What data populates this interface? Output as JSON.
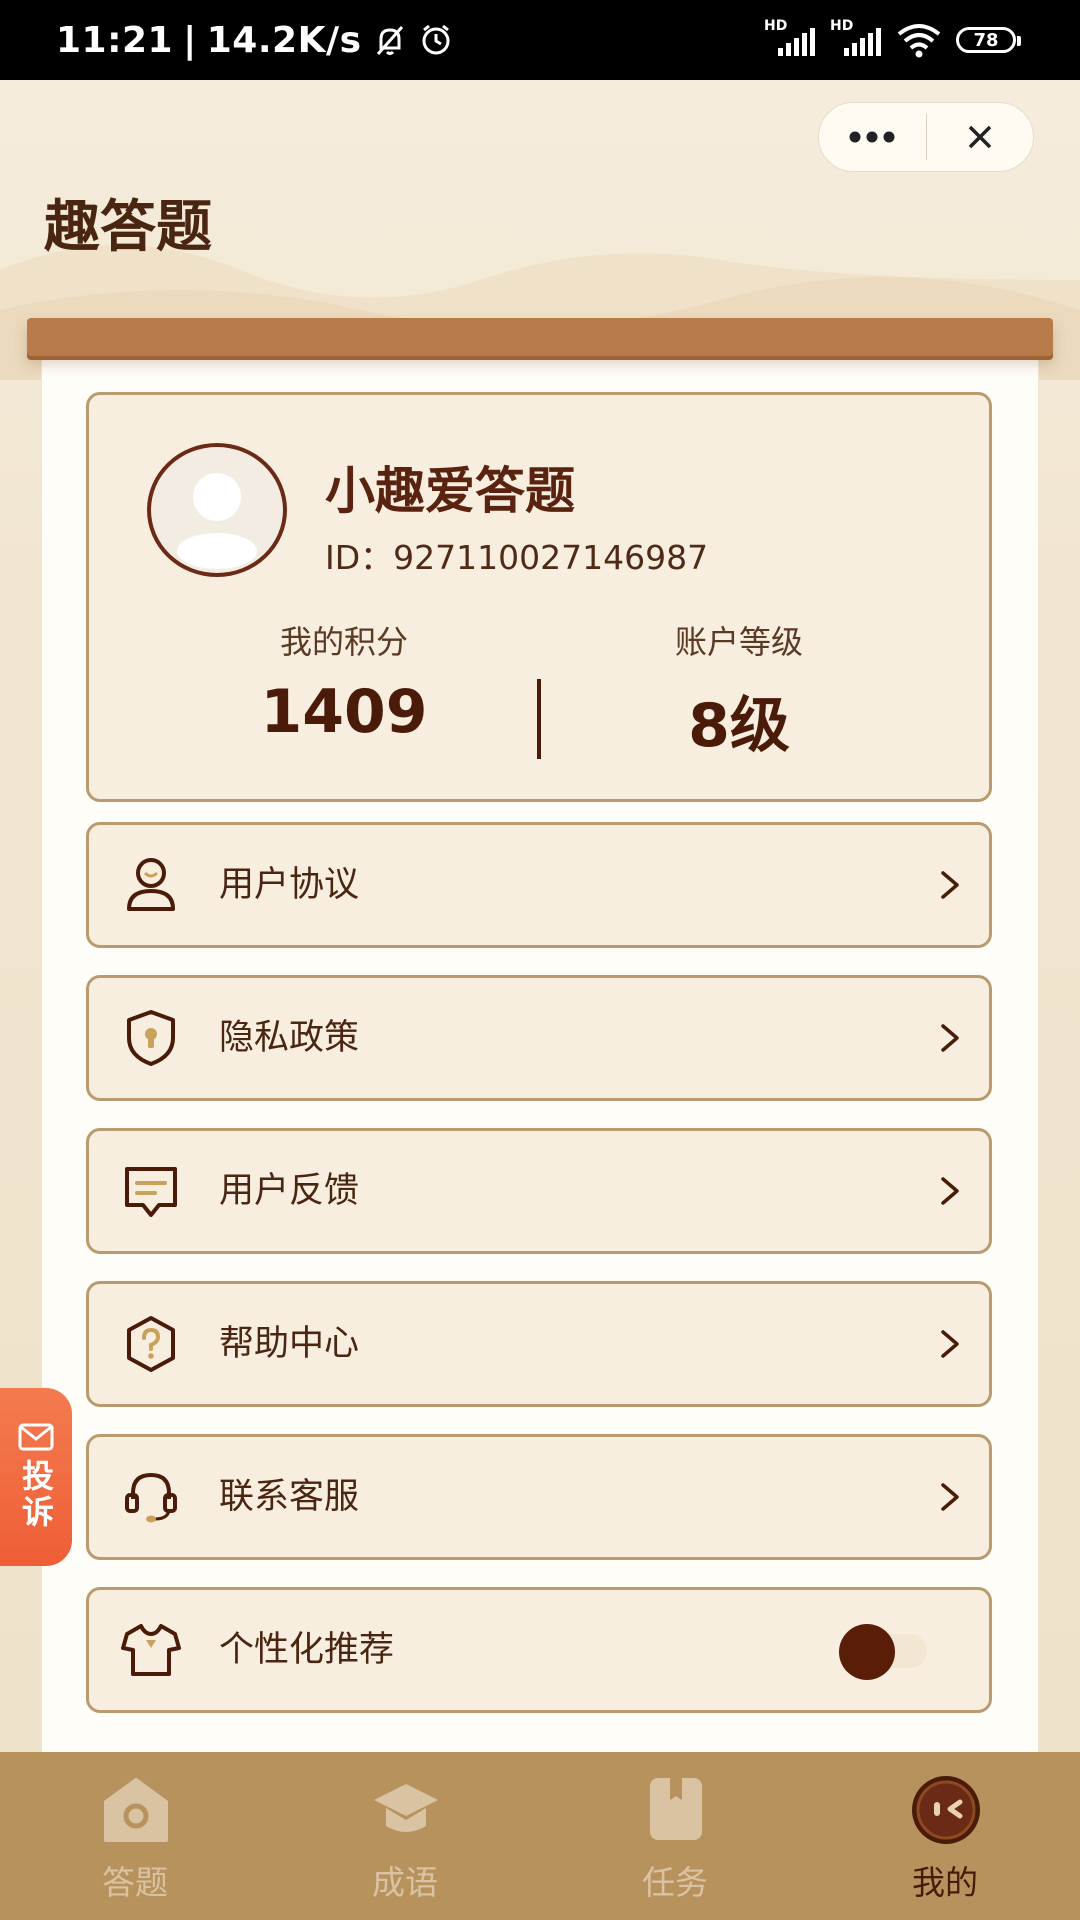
{
  "status_bar": {
    "time": "11:21",
    "separator": "|",
    "net_speed": "14.2K/s",
    "battery": "78",
    "icons": [
      "mute-bell-icon",
      "alarm-icon",
      "signal-hd-icon",
      "signal-hd-icon",
      "wifi-icon",
      "battery-icon"
    ]
  },
  "app": {
    "title": "趣答题"
  },
  "profile": {
    "nickname": "小趣爱答题",
    "id_text": "ID：927110027146987",
    "points_label": "我的积分",
    "points_value": "1409",
    "level_label": "账户等级",
    "level_value": "8级"
  },
  "menu": {
    "items": [
      {
        "label": "用户协议",
        "icon": "user-icon"
      },
      {
        "label": "隐私政策",
        "icon": "shield-lock-icon"
      },
      {
        "label": "用户反馈",
        "icon": "message-icon"
      },
      {
        "label": "帮助中心",
        "icon": "help-icon"
      },
      {
        "label": "联系客服",
        "icon": "headset-icon"
      }
    ],
    "personalized": {
      "label": "个性化推荐",
      "icon": "tshirt-icon",
      "enabled": true
    }
  },
  "complaint_tab": {
    "label": "投诉"
  },
  "tab_bar": {
    "tabs": [
      {
        "label": "答题",
        "icon": "home-icon",
        "active": false
      },
      {
        "label": "成语",
        "icon": "graduation-cap-icon",
        "active": false
      },
      {
        "label": "任务",
        "icon": "book-icon",
        "active": false
      },
      {
        "label": "我的",
        "icon": "profile-face-icon",
        "active": true
      }
    ]
  },
  "colors": {
    "brand_dark": "#4a1b08",
    "card_border": "#b99b6f",
    "card_bg": "#f8eedf",
    "tab_bar_bg": "#b8925c",
    "complaint_orange": "#f0623a"
  }
}
